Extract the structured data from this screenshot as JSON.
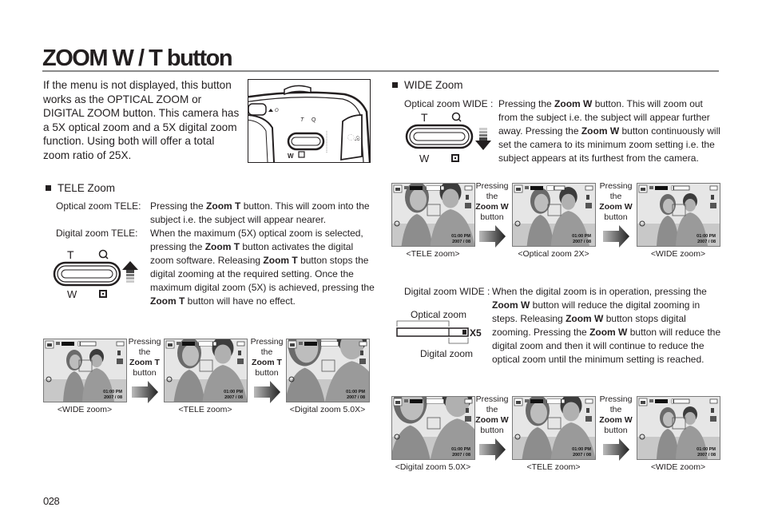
{
  "page": {
    "title": "ZOOM W / T button",
    "intro": "If the menu is not displayed, this button works as the OPTICAL ZOOM or DIGITAL ZOOM button. This camera has a 5X optical zoom and a 5X digital zoom function. Using both will offer a total zoom ratio of 25X.",
    "page_number": "028"
  },
  "camera_illustration": {
    "labels": {
      "t": "T",
      "w": "W"
    },
    "icons": [
      "camera-body",
      "zoom-lever",
      "magnifier-icon",
      "thumbnail-icon",
      "mode-dial",
      "playback-button"
    ]
  },
  "tele": {
    "heading": "TELE Zoom",
    "optical_label": "Optical zoom TELE:",
    "optical_text": [
      "Pressing the ",
      "Zoom T",
      " button. This will zoom into the subject i.e. the subject will appear nearer."
    ],
    "digital_label": "Digital zoom TELE:",
    "digital_text": [
      "When the maximum (5X) optical zoom is selected, pressing the ",
      "Zoom T",
      " button activates the digital zoom software. Releasing ",
      "Zoom T",
      " button stops the digital zooming at the required setting. Once the maximum digital zoom (5X) is achieved, pressing the ",
      "Zoom T",
      " button will have no effect."
    ],
    "button_labels": {
      "t": "T",
      "w": "W"
    },
    "sequence": [
      {
        "caption": "<WIDE zoom>",
        "zoom": "wide",
        "time": "01:00 PM",
        "date": "2007 / 08"
      },
      {
        "caption": "<TELE zoom>",
        "zoom": "tele",
        "time": "01:00 PM",
        "date": "2007 / 08"
      },
      {
        "caption": "<Digital zoom 5.0X>",
        "zoom": "digital",
        "time": "01:00 PM",
        "date": "2007 / 08"
      }
    ],
    "press": {
      "line1": "Pressing",
      "line2": "the",
      "line3": "Zoom T",
      "line4": "button"
    }
  },
  "wide": {
    "heading": "WIDE Zoom",
    "optical_label": "Optical zoom WIDE :",
    "optical_text": [
      "Pressing the ",
      "Zoom W",
      " button. This will zoom out from the subject i.e. the subject will appear further away. Pressing the ",
      "Zoom W",
      " button continuously will set the camera to its minimum zoom setting i.e. the subject appears at its furthest from the camera."
    ],
    "button_labels": {
      "t": "T",
      "w": "W"
    },
    "optical_sequence": [
      {
        "caption": "<TELE zoom>",
        "zoom": "tele",
        "time": "01:00 PM",
        "date": "2007 / 08"
      },
      {
        "caption": "<Optical zoom 2X>",
        "zoom": "optical2x",
        "time": "01:00 PM",
        "date": "2007 / 08"
      },
      {
        "caption": "<WIDE zoom>",
        "zoom": "wide",
        "time": "01:00 PM",
        "date": "2007 / 08"
      }
    ],
    "digital_label": "Digital zoom WIDE :",
    "digital_text": [
      "When the digital zoom is in operation, pressing the ",
      "Zoom W",
      " button will reduce the digital zooming in steps. Releasing ",
      "Zoom W",
      " button stops digital zooming. Pressing the ",
      "Zoom W",
      " button will reduce the digital zoom and then it will continue to reduce the optical zoom until the minimum setting is reached."
    ],
    "zoom_bar": {
      "optical_label": "Optical zoom",
      "digital_label": "Digital zoom",
      "max_label": "X5"
    },
    "digital_sequence": [
      {
        "caption": "<Digital zoom 5.0X>",
        "zoom": "digital",
        "time": "01:00 PM",
        "date": "2007 / 08"
      },
      {
        "caption": "<TELE zoom>",
        "zoom": "tele",
        "time": "01:00 PM",
        "date": "2007 / 08"
      },
      {
        "caption": "<WIDE zoom>",
        "zoom": "wide",
        "time": "01:00 PM",
        "date": "2007 / 08"
      }
    ],
    "press": {
      "line1": "Pressing",
      "line2": "the",
      "line3": "Zoom W",
      "line4": "button"
    }
  }
}
